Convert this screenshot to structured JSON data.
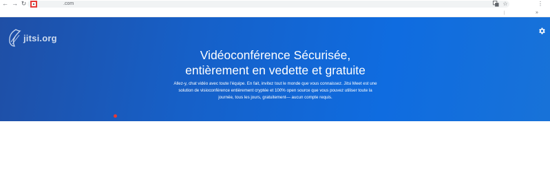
{
  "browser": {
    "back_icon": "←",
    "forward_icon": "→",
    "reload_icon": "↻",
    "url": ".com",
    "translate_icon": "translate-icon",
    "star_icon": "☆",
    "menu_icon": "⋮",
    "bookmarks_separator": "|",
    "bookmarks_more": "»"
  },
  "hero": {
    "logo_text": "jitsi.org",
    "title_line1": "Vidéoconférence Sécurisée,",
    "title_line2": "entièrement en vedette et gratuite",
    "description": "Allez-y, chat vidéo avec toute l'équipe. En fait, invitez tout le monde que vous connaissez. Jitsi Meet est une solution de visioconférence entièrement cryptée et 100% open source que vous pouvez utiliser toute la journée, tous les jours, gratuitement— aucun compte requis.",
    "background_color": "#1660c8"
  }
}
